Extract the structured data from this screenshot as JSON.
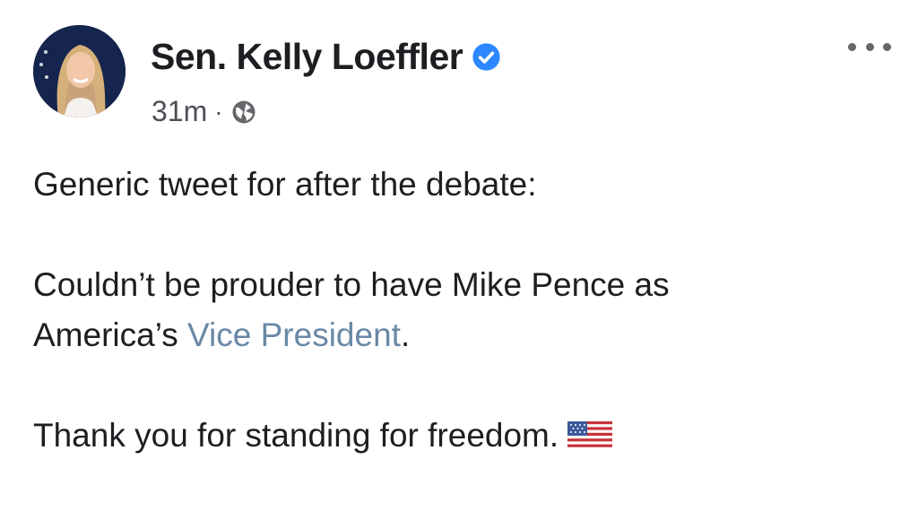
{
  "post": {
    "author": "Sen. Kelly Loeffler",
    "timestamp": "31m",
    "separator": "·",
    "visibility_icon": "globe-icon",
    "verified_icon": "verified-badge-icon",
    "menu_icon": "more-options-icon",
    "lines": {
      "line1": "Generic tweet for after the debate:",
      "line2": "Couldn’t be prouder to have Mike Pence as",
      "line3_prefix": "America’s ",
      "line3_link": "Vice President",
      "line3_suffix": ".",
      "line4": "Thank you for standing for freedom."
    },
    "emoji": "us-flag-icon"
  },
  "colors": {
    "verified": "#2d88ff",
    "link": "#6a88a6",
    "text": "#1c1e21",
    "meta": "#4b4f56"
  }
}
